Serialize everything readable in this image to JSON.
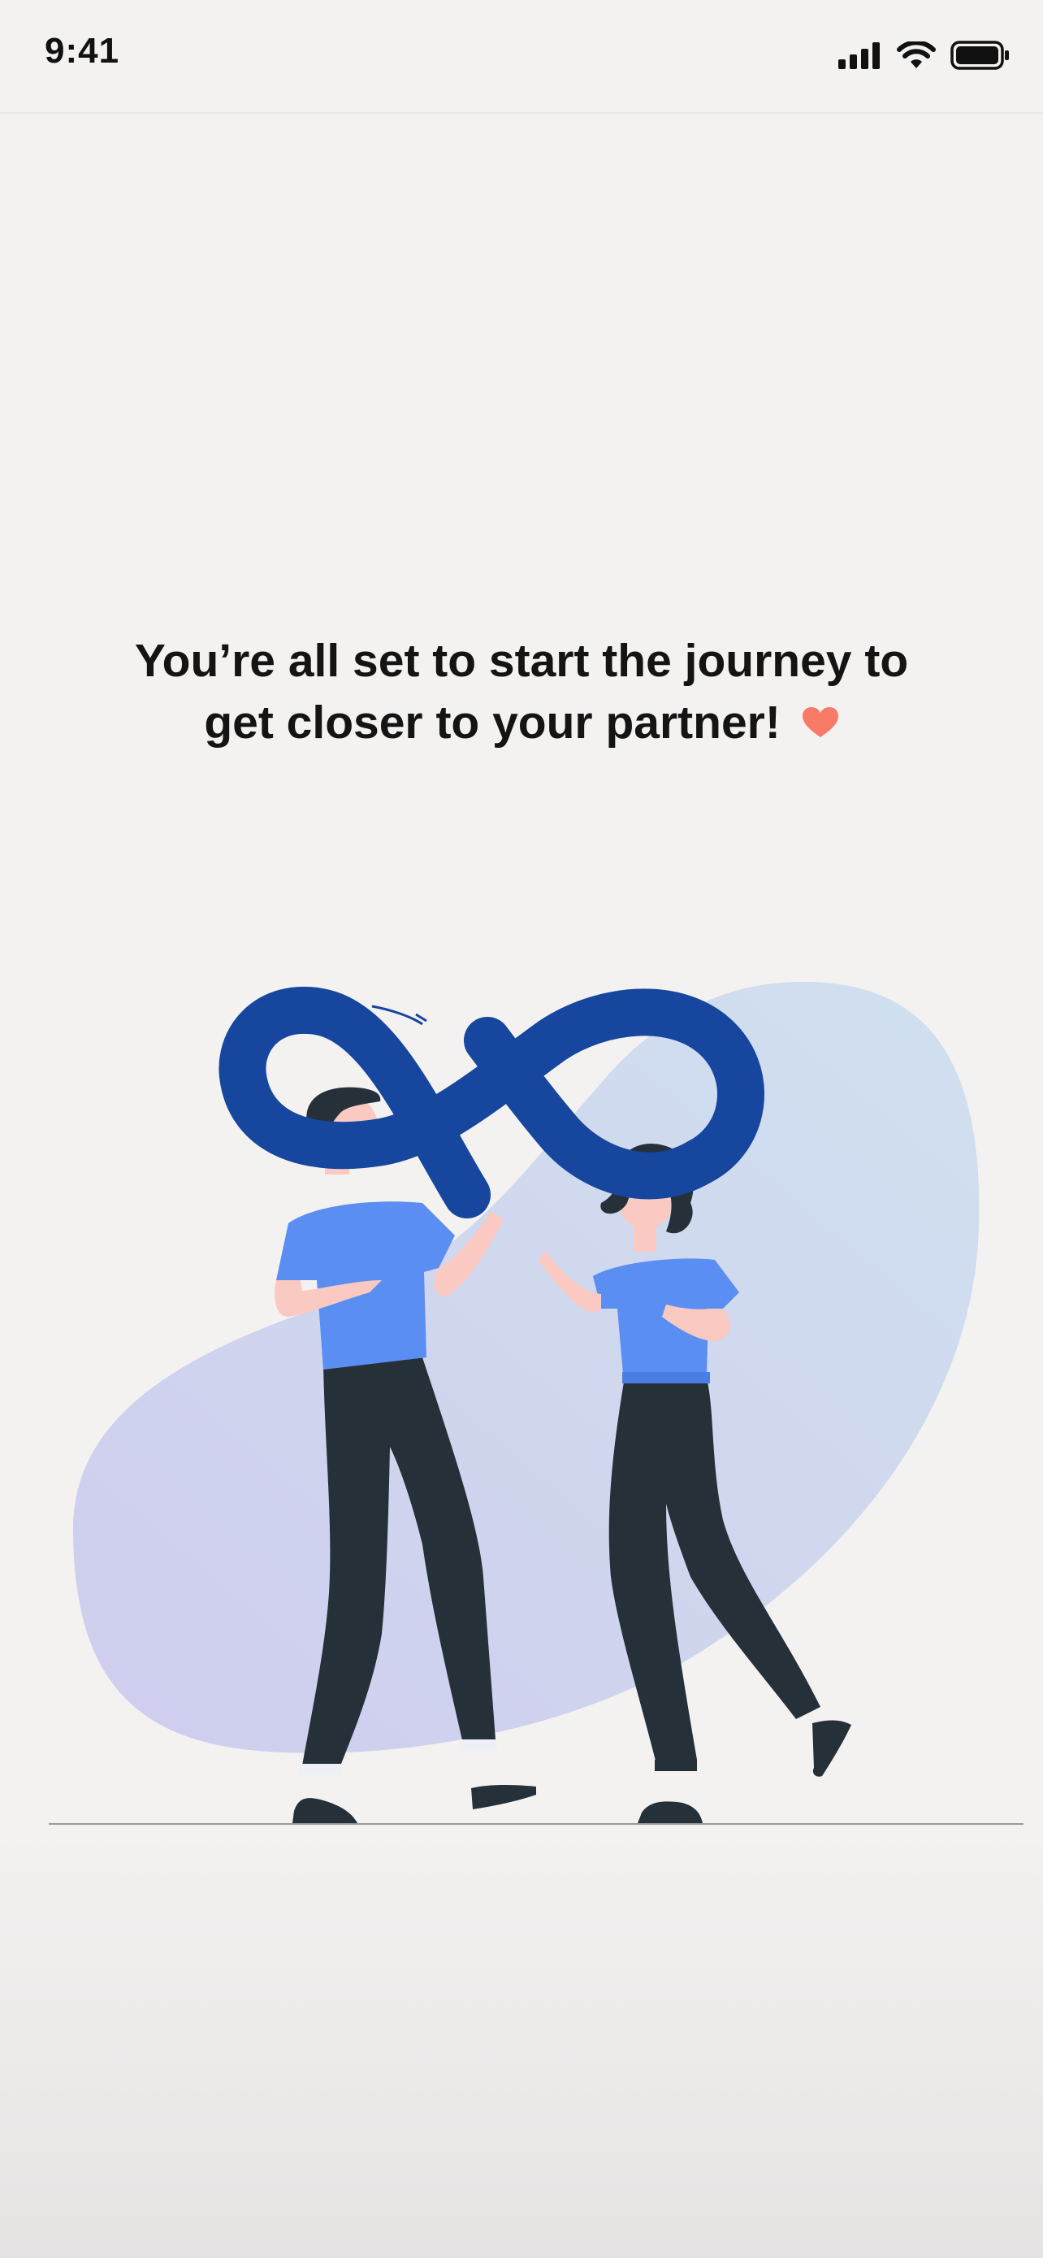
{
  "status_bar": {
    "time": "9:41",
    "icons": [
      "cellular-signal-icon",
      "wifi-icon",
      "battery-icon"
    ]
  },
  "headline": {
    "line1": "You’re all set to start the journey to",
    "line2": "get closer to your partner!",
    "emoji": "heart-icon"
  },
  "illustration": {
    "description_icon": "couple-infinity-illustration"
  },
  "colors": {
    "background": "#f4f2f1",
    "heart": "#f77b67",
    "infinity": "#17469e",
    "shirt": "#5b8ef2",
    "pants": "#263038",
    "blob_start": "#cfcdee",
    "blob_end": "#d0dfef"
  }
}
